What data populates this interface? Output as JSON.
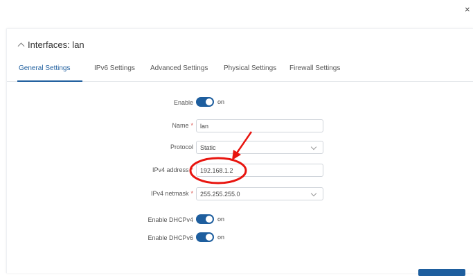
{
  "header": {
    "title": "Interfaces: lan"
  },
  "tabs": [
    {
      "label": "General Settings",
      "active": true
    },
    {
      "label": "IPv6 Settings",
      "active": false
    },
    {
      "label": "Advanced Settings",
      "active": false
    },
    {
      "label": "Physical Settings",
      "active": false
    },
    {
      "label": "Firewall Settings",
      "active": false
    }
  ],
  "form": {
    "enable": {
      "label": "Enable",
      "state": "on"
    },
    "name": {
      "label": "Name",
      "value": "lan",
      "required": "*"
    },
    "protocol": {
      "label": "Protocol",
      "value": "Static"
    },
    "ipv4_address": {
      "label": "IPv4 address",
      "value": "192.168.1.2",
      "required": "*"
    },
    "ipv4_netmask": {
      "label": "IPv4 netmask",
      "value": "255.255.255.0",
      "required": "*"
    },
    "enable_dhcpv4": {
      "label": "Enable DHCPv4",
      "state": "on"
    },
    "enable_dhcpv6": {
      "label": "Enable DHCPv6",
      "state": "on"
    }
  },
  "window": {
    "close_glyph": "×"
  },
  "colors": {
    "accent": "#1e5e9e",
    "annotation": "#e8150f",
    "required": "#d9534f"
  }
}
